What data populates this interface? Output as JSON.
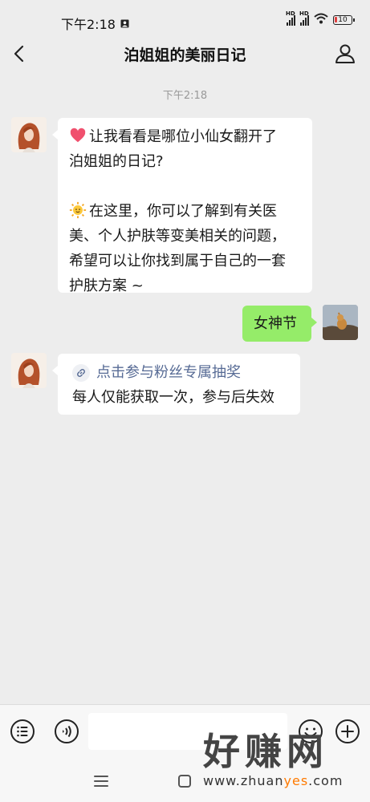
{
  "status_bar": {
    "time": "下午2:18",
    "battery": "10"
  },
  "header": {
    "title": "泊姐姐的美丽日记"
  },
  "chat": {
    "timestamp": "下午2:18",
    "msg1": {
      "lines": [
        "让我看看是哪位小仙女翻开了",
        "泊姐姐的日记?",
        "在这里，你可以了解到有关医",
        "美、个人护肤等变美相关的问题，",
        "希望可以让你找到属于自己的一套",
        "护肤方案 ~"
      ]
    },
    "msg2": {
      "text": "女神节"
    },
    "msg3": {
      "link": "点击参与粉丝专属抽奖",
      "text": "每人仅能获取一次，参与后失效"
    }
  },
  "input": {
    "placeholder": ""
  },
  "watermark": {
    "brand": "好赚网",
    "url_prefix": "www.zhuan",
    "url_highlight": "yes",
    "url_suffix": ".com"
  },
  "colors": {
    "background": "#ededed",
    "self_bubble": "#95ec69",
    "link": "#576b95",
    "timestamp": "#999999"
  },
  "icons": [
    "back-icon",
    "user-icon",
    "heart-icon",
    "sun-icon",
    "link-icon",
    "menu-icon",
    "voice-icon",
    "emoji-icon",
    "plus-icon"
  ]
}
